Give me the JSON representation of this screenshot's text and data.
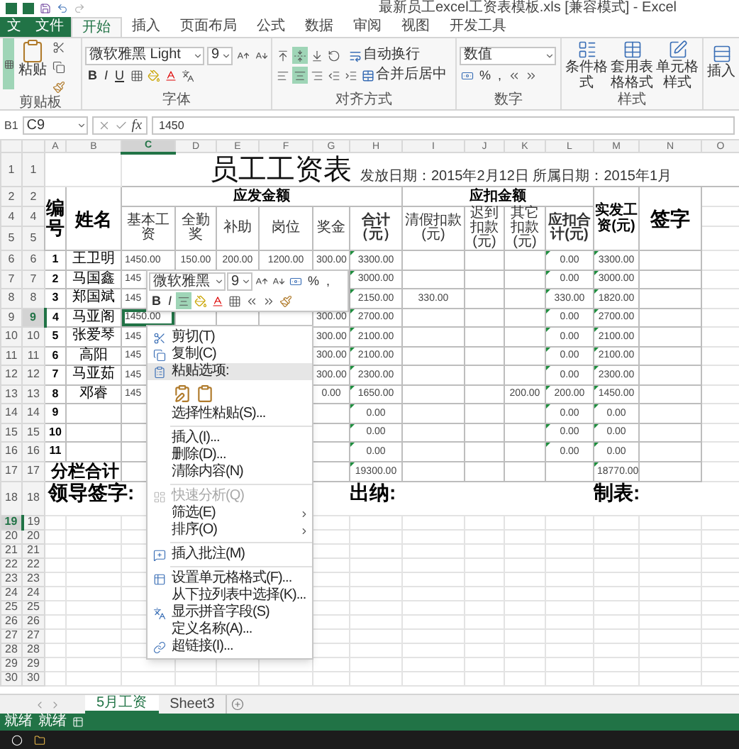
{
  "window": {
    "title": "最新员工excel工资表模板.xls  [兼容模式] - Excel"
  },
  "ribbon_tabs": [
    {
      "label": "文",
      "kind": "file",
      "selected": false
    },
    {
      "label": "文件",
      "kind": "file",
      "selected": false
    },
    {
      "label": "开始",
      "kind": "tab",
      "selected": true
    },
    {
      "label": "插入",
      "kind": "tab",
      "selected": false
    },
    {
      "label": "页面布局",
      "kind": "tab",
      "selected": false
    },
    {
      "label": "公式",
      "kind": "tab",
      "selected": false
    },
    {
      "label": "数据",
      "kind": "tab",
      "selected": false
    },
    {
      "label": "审阅",
      "kind": "tab",
      "selected": false
    },
    {
      "label": "视图",
      "kind": "tab",
      "selected": false
    },
    {
      "label": "开发工具",
      "kind": "tab",
      "selected": false
    }
  ],
  "ribbon": {
    "clipboard": {
      "paste": "粘贴",
      "label": "剪贴板"
    },
    "font": {
      "name": "微软雅黑 Light",
      "size": "9",
      "styles": [
        "B",
        "I",
        "U"
      ],
      "label": "字体"
    },
    "alignment": {
      "vertical_selected": [
        false,
        true,
        false
      ],
      "horizontal_selected": [
        false,
        true,
        false
      ],
      "wrap": "自动换行",
      "merge": "合并后居中",
      "label": "对齐方式"
    },
    "number": {
      "format": "数值",
      "percent": "%",
      "comma": ",",
      "label": "数字"
    },
    "styles": {
      "buttons": [
        "条件格式",
        "套用表格格式",
        "单元格样式"
      ],
      "label": "样式"
    },
    "cells": {
      "buttons": [
        "插入"
      ]
    }
  },
  "formula_bar": {
    "cell_ref": "B1",
    "name_box": "C9",
    "fx": "fx",
    "value": "1450"
  },
  "sheet": {
    "columns": [
      {
        "label": "A",
        "selected": false
      },
      {
        "label": "B",
        "selected": false
      },
      {
        "label": "C",
        "selected": true
      },
      {
        "label": "D",
        "selected": false
      },
      {
        "label": "E",
        "selected": false
      },
      {
        "label": "F",
        "selected": false
      },
      {
        "label": "G",
        "selected": false
      },
      {
        "label": "H",
        "selected": false
      },
      {
        "label": "I",
        "selected": false
      },
      {
        "label": "J",
        "selected": false
      },
      {
        "label": "K",
        "selected": false
      },
      {
        "label": "L",
        "selected": false
      },
      {
        "label": "M",
        "selected": false
      },
      {
        "label": "N",
        "selected": false
      },
      {
        "label": "O",
        "selected": false
      }
    ],
    "row_headers": [
      [
        {
          "label": "1",
          "selected": false
        },
        {
          "label": "1",
          "selected": false
        }
      ],
      [
        {
          "label": "2",
          "selected": false
        },
        {
          "label": "2",
          "selected": false
        }
      ],
      [
        {
          "label": "4",
          "selected": false
        },
        {
          "label": "4",
          "selected": false
        }
      ],
      [
        {
          "label": "5",
          "selected": false
        },
        {
          "label": "5",
          "selected": false
        }
      ],
      [
        {
          "label": "6",
          "selected": false
        },
        {
          "label": "6",
          "selected": false
        }
      ],
      [
        {
          "label": "7",
          "selected": false
        },
        {
          "label": "7",
          "selected": false
        }
      ],
      [
        {
          "label": "8",
          "selected": false
        },
        {
          "label": "8",
          "selected": false
        }
      ],
      [
        {
          "label": "9",
          "selected": false
        },
        {
          "label": "9",
          "selected": true
        }
      ],
      [
        {
          "label": "10",
          "selected": false
        },
        {
          "label": "10",
          "selected": false
        }
      ],
      [
        {
          "label": "11",
          "selected": false
        },
        {
          "label": "11",
          "selected": false
        }
      ],
      [
        {
          "label": "12",
          "selected": false
        },
        {
          "label": "12",
          "selected": false
        }
      ],
      [
        {
          "label": "13",
          "selected": false
        },
        {
          "label": "13",
          "selected": false
        }
      ],
      [
        {
          "label": "14",
          "selected": false
        },
        {
          "label": "14",
          "selected": false
        }
      ],
      [
        {
          "label": "15",
          "selected": false
        },
        {
          "label": "15",
          "selected": false
        }
      ],
      [
        {
          "label": "16",
          "selected": false
        },
        {
          "label": "16",
          "selected": false
        }
      ],
      [
        {
          "label": "17",
          "selected": false
        },
        {
          "label": "17",
          "selected": false
        }
      ],
      [
        {
          "label": "18",
          "selected": false
        },
        {
          "label": "18",
          "selected": false
        }
      ],
      [
        {
          "label": "19",
          "selected": true
        },
        {
          "label": "19",
          "selected": false
        }
      ],
      [
        {
          "label": "20",
          "selected": false
        },
        {
          "label": "20",
          "selected": false
        }
      ],
      [
        {
          "label": "21",
          "selected": false
        },
        {
          "label": "21",
          "selected": false
        }
      ],
      [
        {
          "label": "22",
          "selected": false
        },
        {
          "label": "22",
          "selected": false
        }
      ],
      [
        {
          "label": "23",
          "selected": false
        },
        {
          "label": "23",
          "selected": false
        }
      ],
      [
        {
          "label": "24",
          "selected": false
        },
        {
          "label": "24",
          "selected": false
        }
      ],
      [
        {
          "label": "25",
          "selected": false
        },
        {
          "label": "25",
          "selected": false
        }
      ],
      [
        {
          "label": "26",
          "selected": false
        },
        {
          "label": "26",
          "selected": false
        }
      ],
      [
        {
          "label": "27",
          "selected": false
        },
        {
          "label": "27",
          "selected": false
        }
      ],
      [
        {
          "label": "28",
          "selected": false
        },
        {
          "label": "28",
          "selected": false
        }
      ],
      [
        {
          "label": "29",
          "selected": false
        },
        {
          "label": "29",
          "selected": false
        }
      ],
      [
        {
          "label": "30",
          "selected": false
        },
        {
          "label": "30",
          "selected": false
        }
      ]
    ],
    "title": "员工工资表",
    "subtitle": "发放日期：2015年2月12日 所属日期：2015年1月",
    "header": {
      "number": "编号",
      "name": "姓名",
      "gross": "应发金额",
      "gross_items": [
        "基本工资",
        "全勤奖",
        "补助",
        "岗位",
        "奖金",
        "合计（元）"
      ],
      "deductions": "应扣金额",
      "deduction_items": [
        "清假扣款(元)",
        "迟到扣款(元)",
        "其它扣款(元)",
        "应扣合计(元)"
      ],
      "net": "实发工资(元)",
      "sign": "签字"
    },
    "rows": [
      {
        "no": "1",
        "name": "王卫明",
        "selected": false,
        "values": {
          "C": "1450.00",
          "D": "150.00",
          "E": "200.00",
          "F": "1200.00",
          "G": "300.00",
          "H": "3300.00",
          "L": "0.00",
          "M": "3300.00"
        },
        "flags": {
          "H": true,
          "L": true,
          "M": true
        }
      },
      {
        "no": "2",
        "name": "马国鑫",
        "selected": false,
        "values": {
          "C": "145",
          "H": "3000.00",
          "L": "0.00",
          "M": "3000.00"
        },
        "flags": {
          "H": true,
          "L": true,
          "M": true
        }
      },
      {
        "no": "3",
        "name": "郑国斌",
        "selected": false,
        "values": {
          "C": "145",
          "H": "2150.00",
          "I": "330.00",
          "L": "330.00",
          "M": "1820.00"
        },
        "flags": {
          "H": true,
          "L": true,
          "M": true
        }
      },
      {
        "no": "4",
        "name": "马亚阁",
        "selected": true,
        "values": {
          "C": "1450.00",
          "G": "300.00",
          "H": "2700.00",
          "L": "0.00",
          "M": "2700.00"
        },
        "flags": {
          "H": true,
          "L": true,
          "M": true
        }
      },
      {
        "no": "5",
        "name": "张爱琴",
        "selected": false,
        "values": {
          "C": "145",
          "G": "300.00",
          "H": "2100.00",
          "L": "0.00",
          "M": "2100.00"
        },
        "flags": {
          "H": true,
          "L": true,
          "M": true
        }
      },
      {
        "no": "6",
        "name": "高阳",
        "selected": false,
        "values": {
          "C": "145",
          "G": "300.00",
          "H": "2100.00",
          "L": "0.00",
          "M": "2100.00"
        },
        "flags": {
          "H": true,
          "L": true,
          "M": true
        }
      },
      {
        "no": "7",
        "name": "马亚茹",
        "selected": false,
        "values": {
          "C": "145",
          "G": "300.00",
          "H": "2300.00",
          "L": "0.00",
          "M": "2300.00"
        },
        "flags": {
          "H": true,
          "L": true,
          "M": true
        }
      },
      {
        "no": "8",
        "name": "邓睿",
        "selected": false,
        "values": {
          "C": "145",
          "G": "0.00",
          "H": "1650.00",
          "K": "200.00",
          "L": "200.00",
          "M": "1450.00"
        },
        "flags": {
          "H": true,
          "L": true,
          "M": true
        }
      },
      {
        "no": "9",
        "selected": false,
        "values": {
          "H": "0.00",
          "L": "0.00",
          "M": "0.00"
        },
        "flags": {
          "H": true,
          "L": true,
          "M": true
        }
      },
      {
        "no": "10",
        "selected": false,
        "values": {
          "H": "0.00",
          "L": "0.00",
          "M": "0.00"
        },
        "flags": {
          "H": true,
          "L": true,
          "M": true
        }
      },
      {
        "no": "11",
        "selected": false,
        "values": {
          "H": "0.00",
          "L": "0.00",
          "M": "0.00"
        },
        "flags": {
          "H": true,
          "L": true,
          "M": true
        }
      }
    ],
    "total": {
      "label": "分栏合计",
      "values": {
        "H": "19300.00",
        "M": "18770.00"
      },
      "flags": {
        "H": true,
        "M": true
      }
    },
    "signatures": [
      "领导签字:",
      "出纳:",
      "制表:"
    ]
  },
  "mini_toolbar": {
    "font": "微软雅黑",
    "size": "9",
    "percent": "%",
    "comma": ",",
    "bold": "B",
    "italic": "I",
    "center_on": true
  },
  "context_menu": {
    "items": [
      {
        "label": "剪切(T)",
        "kind": "item",
        "disabled": false
      },
      {
        "label": "复制(C)",
        "kind": "item",
        "disabled": false
      },
      {
        "label": "粘贴选项:",
        "kind": "header",
        "disabled": false
      },
      {
        "kind": "paste_options"
      },
      {
        "label": "选择性粘贴(S)...",
        "kind": "item",
        "disabled": false
      },
      {
        "kind": "separator"
      },
      {
        "label": "插入(I)...",
        "kind": "item",
        "disabled": false
      },
      {
        "label": "删除(D)...",
        "kind": "item",
        "disabled": false
      },
      {
        "label": "清除内容(N)",
        "kind": "item",
        "disabled": false
      },
      {
        "kind": "separator"
      },
      {
        "label": "快速分析(Q)",
        "kind": "item",
        "disabled": true
      },
      {
        "label": "筛选(E)",
        "kind": "submenu",
        "disabled": false
      },
      {
        "label": "排序(O)",
        "kind": "submenu",
        "disabled": false
      },
      {
        "kind": "separator"
      },
      {
        "label": "插入批注(M)",
        "kind": "item",
        "disabled": false
      },
      {
        "kind": "separator"
      },
      {
        "label": "设置单元格格式(F)...",
        "kind": "item",
        "disabled": false
      },
      {
        "label": "从下拉列表中选择(K)...",
        "kind": "item",
        "disabled": false
      },
      {
        "label": "显示拼音字段(S)",
        "kind": "item",
        "disabled": false
      },
      {
        "label": "定义名称(A)...",
        "kind": "item",
        "disabled": false
      },
      {
        "label": "超链接(I)...",
        "kind": "item",
        "disabled": false
      }
    ]
  },
  "sheet_tabs": [
    {
      "label": "5月工资",
      "selected": true
    },
    {
      "label": "Sheet3",
      "selected": false
    }
  ],
  "status_bar": {
    "texts": [
      "就绪",
      "就绪"
    ]
  }
}
